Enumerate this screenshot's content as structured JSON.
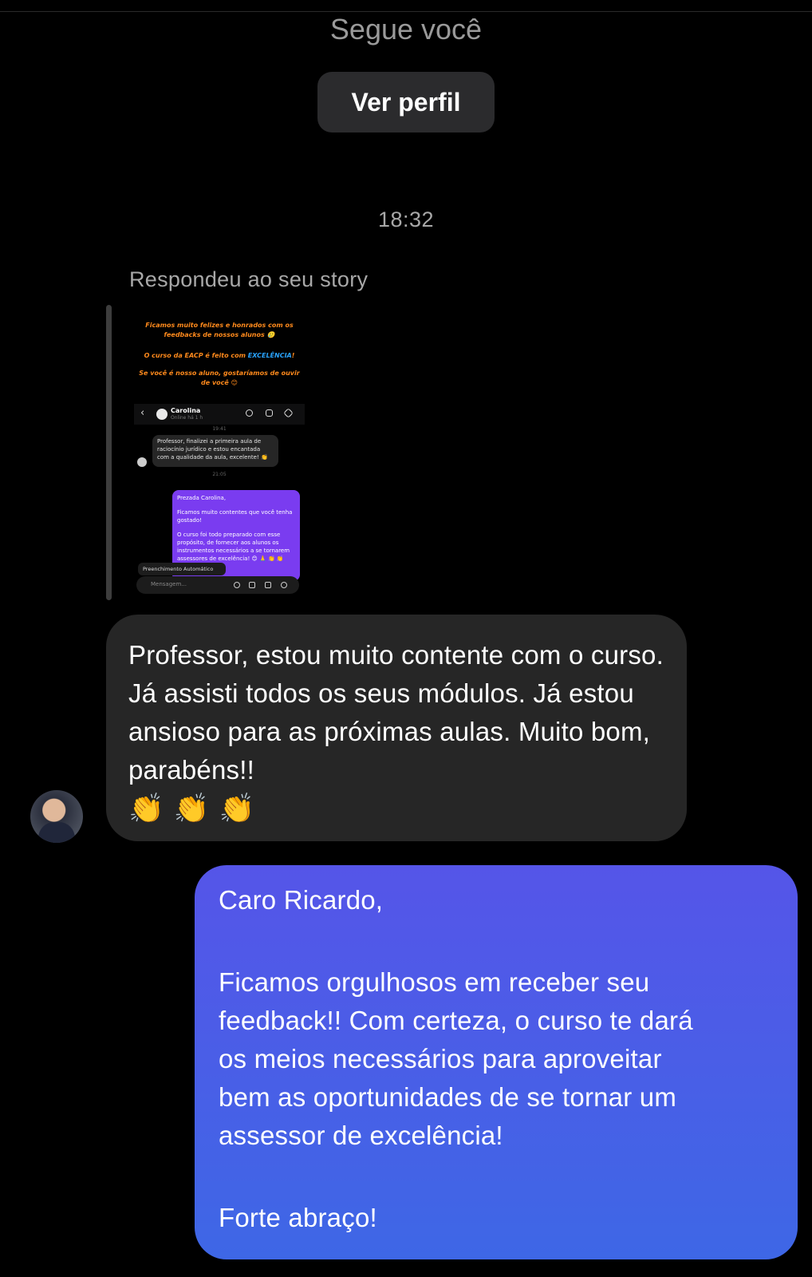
{
  "header": {
    "follows_text": "Segue você",
    "view_profile_label": "Ver perfil"
  },
  "thread": {
    "timestamp": "18:32",
    "reply_context": "Respondeu ao seu story"
  },
  "story_preview": {
    "line1": "Ficamos muito felizes e honrados com os feedbacks de nossos alunos 🥲",
    "line2a": "O curso da EACP é feito com ",
    "line2b": "EXCELÊNCIA",
    "line2c": "!",
    "line3": "Se você é nosso aluno, gostaríamos de ouvir de você 😊",
    "contact_name": "Carolina",
    "contact_status": "Online há 1 h",
    "time1": "19:41",
    "incoming": "Professor, finalizei a primeira aula de raciocínio jurídico e estou encantada com a qualidade da aula, excelente! 👏",
    "time2": "21:05",
    "outgoing_p1": "Prezada Carolina,",
    "outgoing_p2": "Ficamos muito contentes que você tenha gostado!",
    "outgoing_p3": "O curso foi todo preparado com esse propósito, de fornecer aos alunos os instrumentos necessários a se tornarem assessores de excelência! 😊 🙏 👏 👏",
    "autofill_tip": "Preenchimento Automático",
    "message_placeholder": "Mensagem..."
  },
  "messages": {
    "incoming": {
      "text": "Professor, estou muito contente com o curso. Já assisti todos os seus módulos. Já estou ansioso para as próximas aulas. Muito bom, parabéns!!",
      "emoji": [
        "👏",
        "👏",
        "👏"
      ]
    },
    "outgoing": {
      "greeting": "Caro Ricardo,",
      "body_lines": [
        "Ficamos orgulhosos em receber seu",
        "feedback!! Com certeza, o curso te dará",
        "os meios necessários para aproveitar",
        "bem as oportunidades de se tornar um",
        "assessor de excelência!"
      ],
      "closing": "Forte abraço!"
    }
  },
  "colors": {
    "background": "#000000",
    "incoming_bubble": "#262626",
    "outgoing_gradient_top": "#5555e8",
    "outgoing_gradient_bottom": "#3e67e6",
    "story_accent": "#ff8a1c",
    "story_highlight": "#29a4ff",
    "story_outgoing": "#7a3cf0"
  }
}
